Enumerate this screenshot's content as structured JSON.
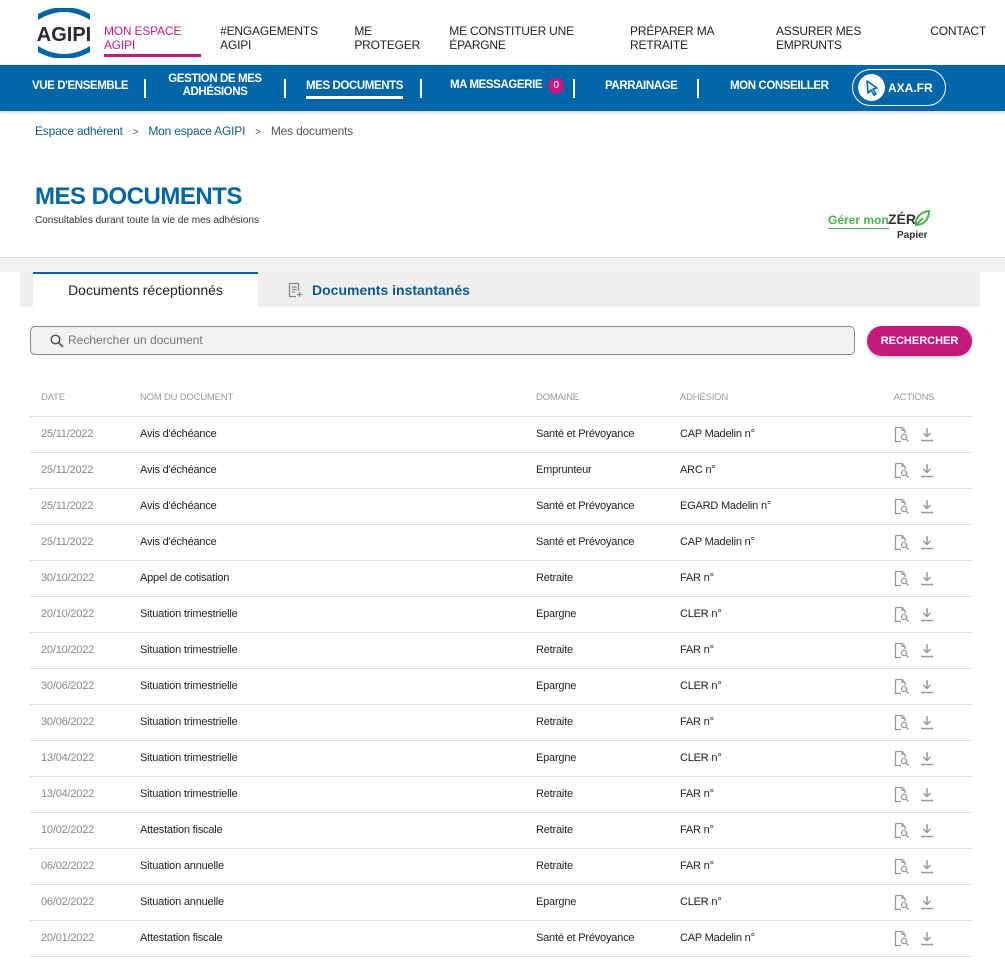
{
  "brand": {
    "logo_text": "AGIPI",
    "accent": "#c4197f",
    "primary": "#0066a8"
  },
  "topnav": [
    {
      "label": "MON ESPACE AGIPI",
      "active": true
    },
    {
      "label": "#ENGAGEMENTS AGIPI"
    },
    {
      "label": "ME PROTEGER"
    },
    {
      "label": "ME CONSTITUER UNE ÉPARGNE"
    },
    {
      "label": "PRÉPARER MA RETRAITE"
    },
    {
      "label": "ASSURER MES EMPRUNTS"
    },
    {
      "label": "CONTACT"
    }
  ],
  "subnav": {
    "overview": "VUE D'ENSEMBLE",
    "adhesions_1": "GESTION DE MES",
    "adhesions_2": "ADHÉSIONS",
    "documents": "MES DOCUMENTS",
    "messagerie": "MA MESSAGERIE",
    "messagerie_count": "0",
    "parrainage": "PARRAINAGE",
    "conseiller": "MON CONSEILLER",
    "axa": "AXA.FR"
  },
  "breadcrumb": [
    "Espace adhérent",
    "Mon espace AGIPI",
    "Mes documents"
  ],
  "breadcrumb_sep": ">",
  "page": {
    "title": "MES DOCUMENTS",
    "subtitle": "Consultables durant toute la vie de mes adhésions",
    "zero_link": "Gérer mon",
    "zero_word": "ZÉR",
    "zero_sub": "Papier"
  },
  "tabs": {
    "received": "Documents réceptionnés",
    "instant": "Documents instantanés"
  },
  "search": {
    "placeholder": "Rechercher un document",
    "button": "RECHERCHER"
  },
  "table": {
    "headers": [
      "DATE",
      "NOM DU DOCUMENT",
      "DOMAINE",
      "ADHÉSION",
      "ACTIONS"
    ],
    "rows": [
      [
        "25/11/2022",
        "Avis d'échéance",
        "Santé et Prévoyance",
        "CAP Madelin n°"
      ],
      [
        "25/11/2022",
        "Avis d'échéance",
        "Emprunteur",
        "ARC n°"
      ],
      [
        "25/11/2022",
        "Avis d'échéance",
        "Santé et Prévoyance",
        "EGARD Madelin n°"
      ],
      [
        "25/11/2022",
        "Avis d'échéance",
        "Santé et Prévoyance",
        "CAP Madelin n°"
      ],
      [
        "30/10/2022",
        "Appel de cotisation",
        "Retraite",
        "FAR n°"
      ],
      [
        "20/10/2022",
        "Situation trimestrielle",
        "Epargne",
        "CLER n°"
      ],
      [
        "20/10/2022",
        "Situation trimestrielle",
        "Retraite",
        "FAR n°"
      ],
      [
        "30/06/2022",
        "Situation trimestrielle",
        "Epargne",
        "CLER n°"
      ],
      [
        "30/06/2022",
        "Situation trimestrielle",
        "Retraite",
        "FAR n°"
      ],
      [
        "13/04/2022",
        "Situation trimestrielle",
        "Epargne",
        "CLER n°"
      ],
      [
        "13/04/2022",
        "Situation trimestrielle",
        "Retraite",
        "FAR n°"
      ],
      [
        "10/02/2022",
        "Attestation fiscale",
        "Retraite",
        "FAR n°"
      ],
      [
        "06/02/2022",
        "Situation annuelle",
        "Retraite",
        "FAR n°"
      ],
      [
        "06/02/2022",
        "Situation annuelle",
        "Epargne",
        "CLER n°"
      ],
      [
        "20/01/2022",
        "Attestation fiscale",
        "Santé et Prévoyance",
        "CAP Madelin n°"
      ]
    ]
  }
}
